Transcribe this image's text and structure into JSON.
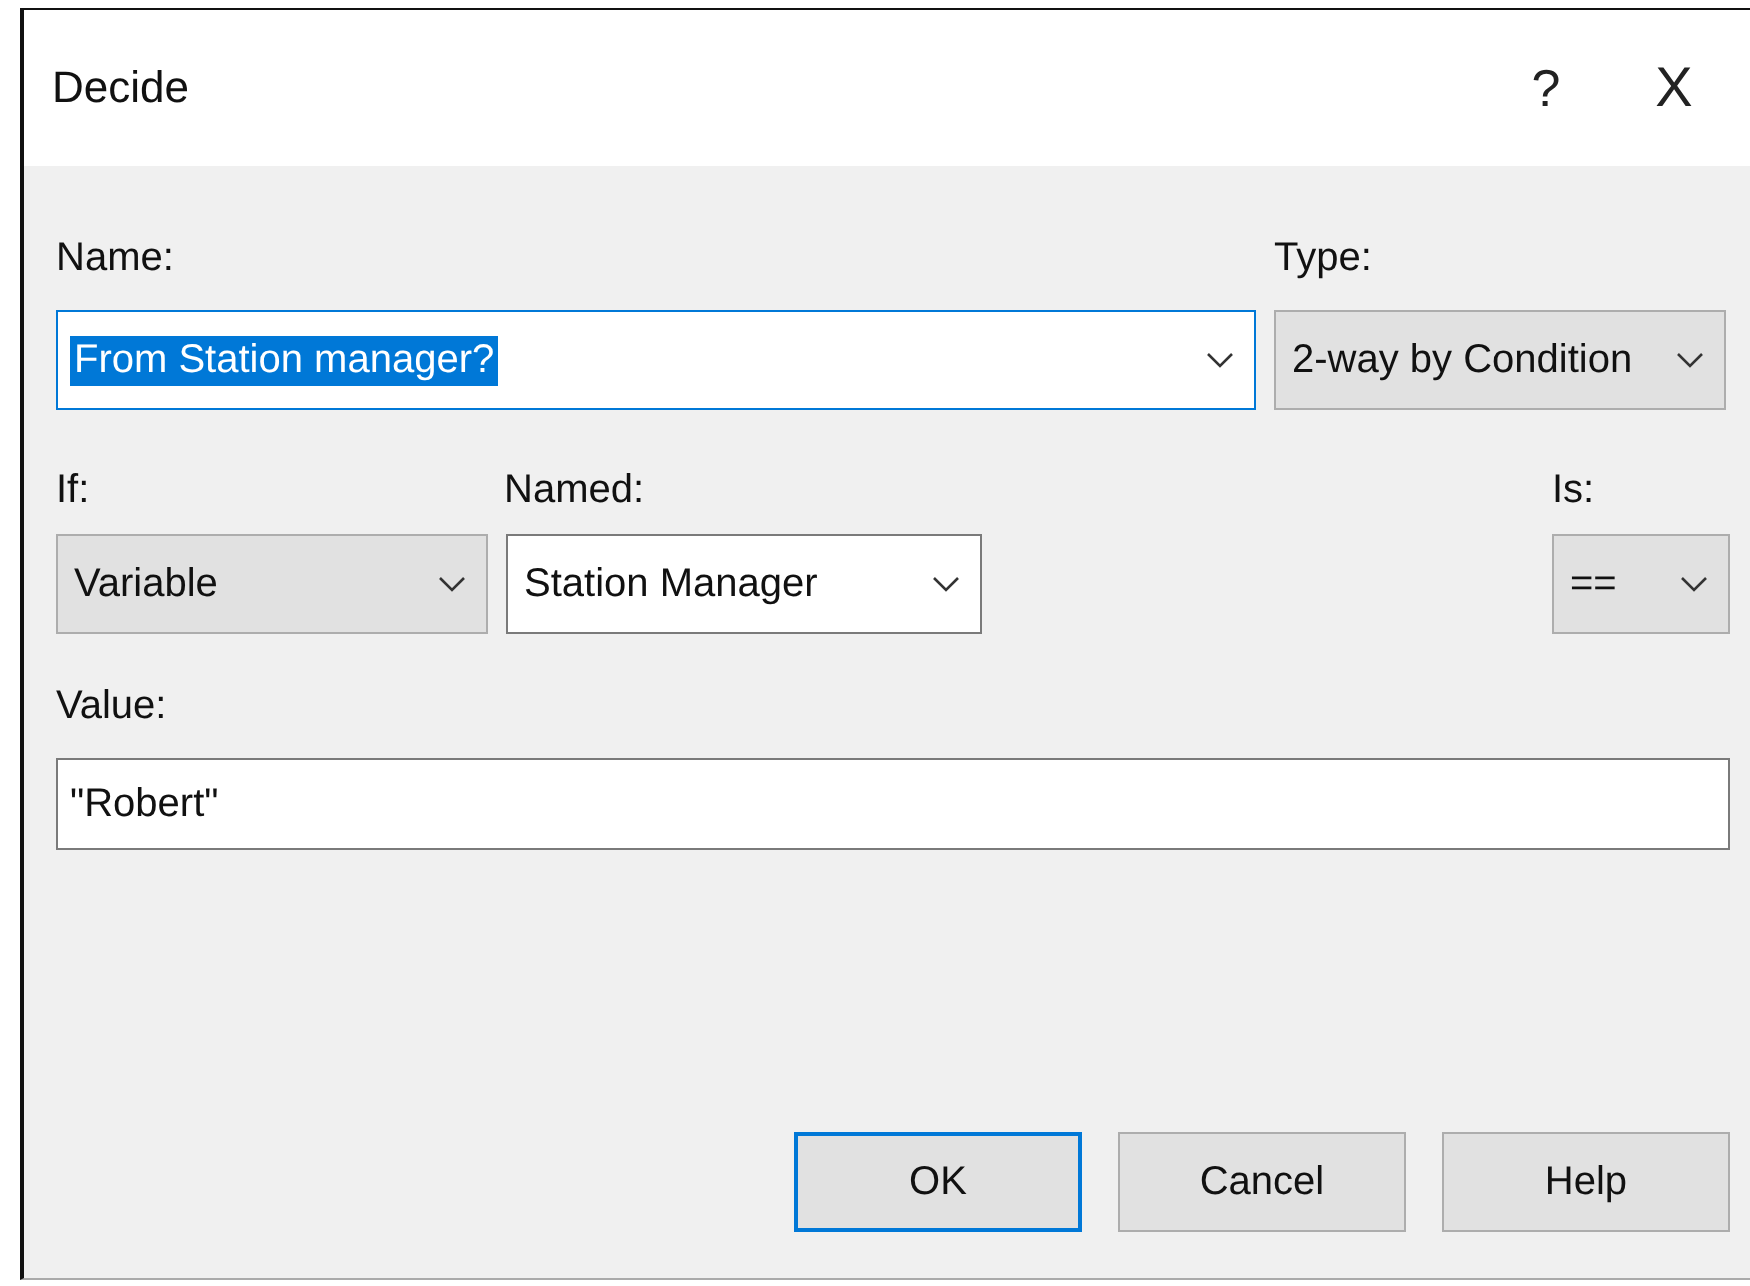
{
  "window": {
    "title": "Decide",
    "help": "?",
    "close": "X"
  },
  "name": {
    "label": "Name:",
    "value": "From Station manager?",
    "text_selected": true,
    "focused": true,
    "kind": "editable"
  },
  "type": {
    "label": "Type:",
    "value": "2-way by Condition",
    "kind": "dropdown"
  },
  "if": {
    "label": "If:",
    "value": "Variable",
    "kind": "dropdown"
  },
  "named": {
    "label": "Named:",
    "value": "Station Manager",
    "kind": "editable"
  },
  "is": {
    "label": "Is:",
    "value": "==",
    "kind": "dropdown"
  },
  "value": {
    "label": "Value:",
    "value": "\"Robert\""
  },
  "buttons": [
    {
      "label": "OK",
      "default": true
    },
    {
      "label": "Cancel",
      "default": false
    },
    {
      "label": "Help",
      "default": false
    }
  ]
}
